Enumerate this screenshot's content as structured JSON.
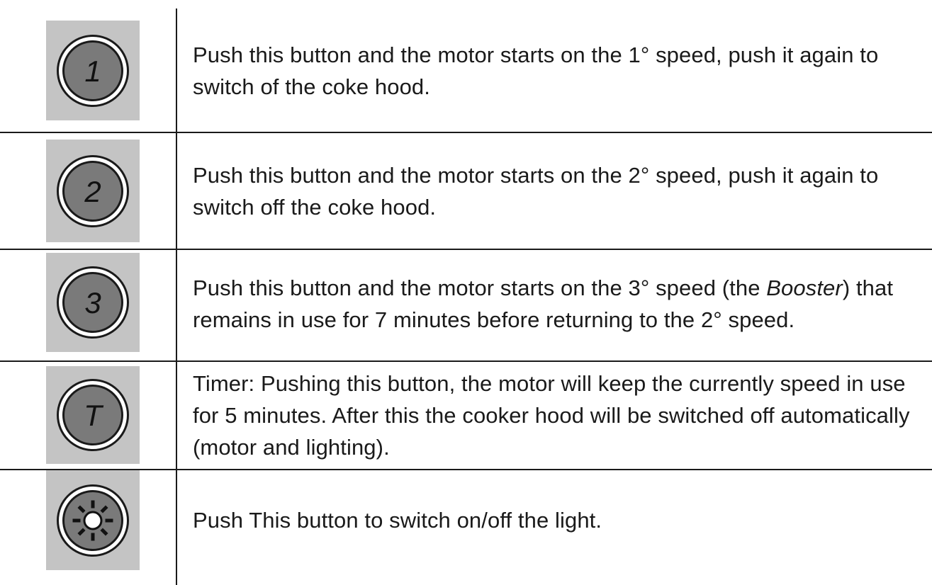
{
  "rows": [
    {
      "icon": "button-1-icon",
      "glyph": "1",
      "text": "Push this button and the motor starts on the 1° speed, push it again to switch of the coke hood."
    },
    {
      "icon": "button-2-icon",
      "glyph": "2",
      "text": "Push this button and the motor starts on the 2° speed, push it again to switch off the coke hood."
    },
    {
      "icon": "button-3-icon",
      "glyph": "3",
      "text_before": "Push this button and the motor starts on the 3° speed (the ",
      "text_emphasis": "Booster",
      "text_after": ") that remains in use for 7 minutes before returning to the 2° speed."
    },
    {
      "icon": "button-timer-icon",
      "glyph": "T",
      "text": "Timer: Pushing this button, the motor will keep the currently speed in use for 5 minutes. After this the cooker hood will be switched off automatically (motor and lighting)."
    },
    {
      "icon": "light-icon",
      "text": "Push This button to switch on/off the light."
    }
  ]
}
